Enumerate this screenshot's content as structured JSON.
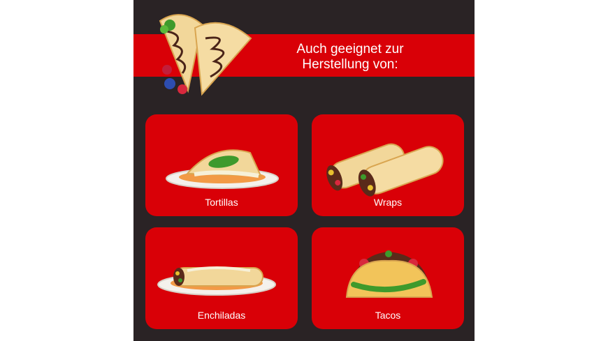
{
  "headline": {
    "line1": "Auch geeignet zur",
    "line2": "Herstellung von:"
  },
  "cards": [
    {
      "label": "Tortillas",
      "icon": "quesadilla-plate-icon"
    },
    {
      "label": "Wraps",
      "icon": "burrito-wraps-icon"
    },
    {
      "label": "Enchiladas",
      "icon": "enchilada-plate-icon"
    },
    {
      "label": "Tacos",
      "icon": "taco-icon"
    }
  ],
  "hero": {
    "icon": "crepes-with-chocolate-icon"
  },
  "colors": {
    "panel_bg": "#2a2325",
    "accent_red": "#d90007",
    "text": "#ffffff"
  }
}
